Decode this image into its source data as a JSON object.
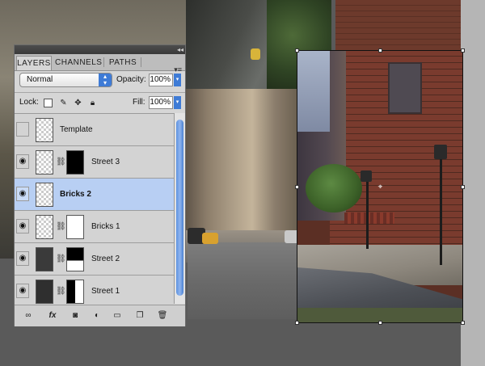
{
  "panel": {
    "tabs": [
      {
        "label": "LAYERS",
        "active": true
      },
      {
        "label": "CHANNELS",
        "active": false
      },
      {
        "label": "PATHS",
        "active": false
      }
    ],
    "menu_icon": "panel-menu-icon",
    "blend_mode": "Normal",
    "opacity_label": "Opacity:",
    "opacity_value": "100%",
    "lock_label": "Lock:",
    "fill_label": "Fill:",
    "fill_value": "100%",
    "layers": [
      {
        "name": "Template",
        "visible": false,
        "has_mask": false,
        "selected": false
      },
      {
        "name": "Street 3",
        "visible": true,
        "has_mask": true,
        "selected": false
      },
      {
        "name": "Bricks 2",
        "visible": true,
        "has_mask": false,
        "selected": true
      },
      {
        "name": "Bricks 1",
        "visible": true,
        "has_mask": true,
        "selected": false
      },
      {
        "name": "Street 2",
        "visible": true,
        "has_mask": true,
        "selected": false
      },
      {
        "name": "Street 1",
        "visible": true,
        "has_mask": true,
        "selected": false
      }
    ],
    "footer_icons": [
      "link-layers-icon",
      "fx-icon",
      "add-mask-icon",
      "adjustment-layer-icon",
      "new-group-icon",
      "new-layer-icon",
      "trash-icon"
    ]
  },
  "colors": {
    "accent_blue": "#3e7bd6",
    "selected_row": "#b8cff3"
  }
}
